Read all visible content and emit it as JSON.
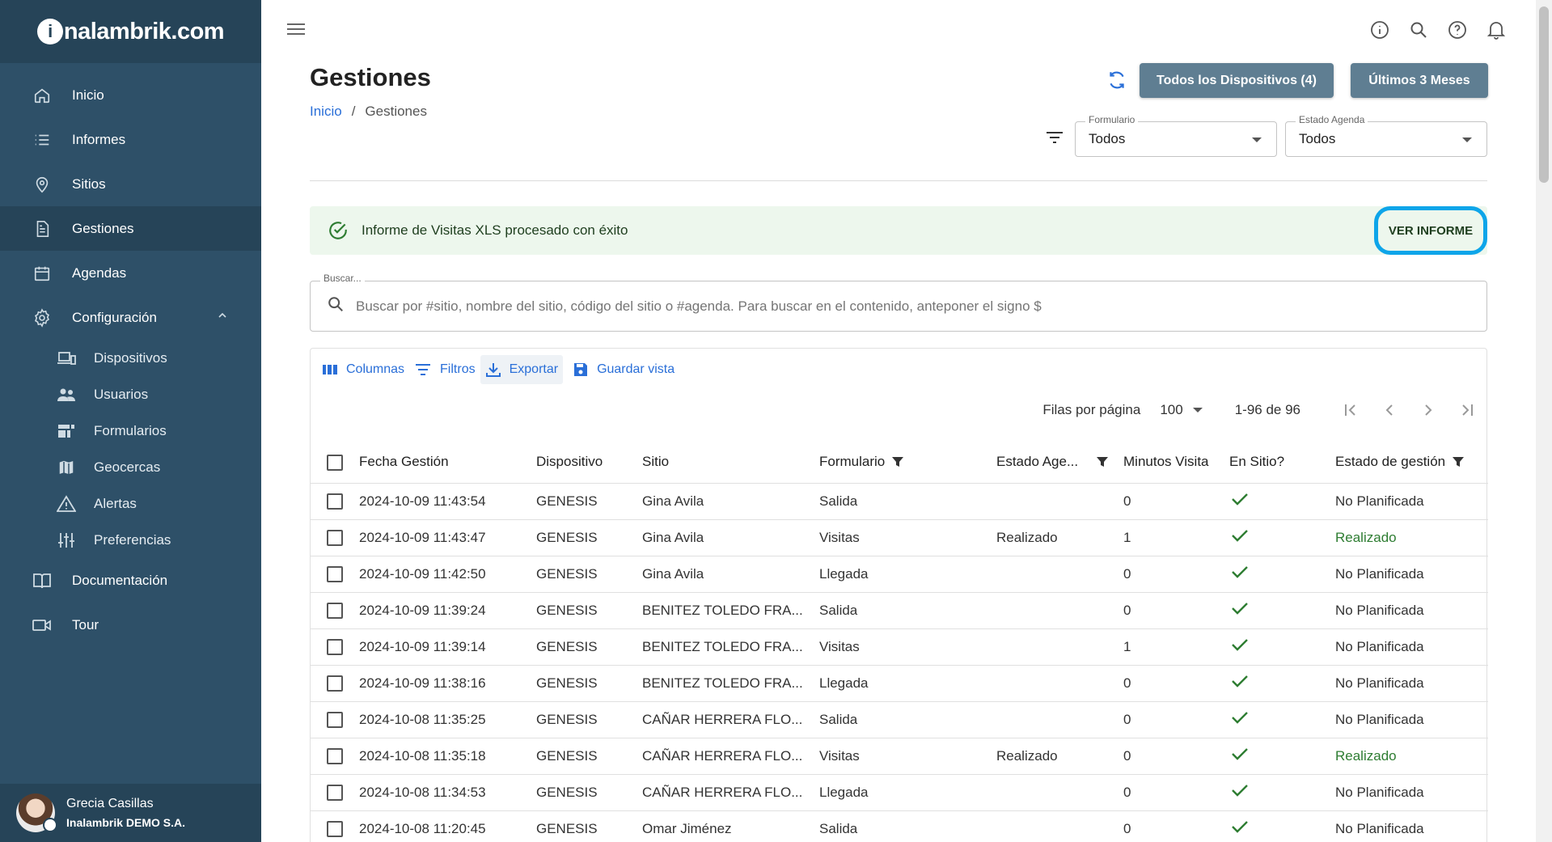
{
  "brand": {
    "logo_text": "nalambrik.com",
    "logo_letter": "i"
  },
  "sidebar": {
    "items": [
      {
        "label": "Inicio",
        "icon": "home-icon"
      },
      {
        "label": "Informes",
        "icon": "list-icon"
      },
      {
        "label": "Sitios",
        "icon": "location-pin-icon"
      },
      {
        "label": "Gestiones",
        "icon": "document-icon",
        "active": true
      },
      {
        "label": "Agendas",
        "icon": "calendar-icon"
      },
      {
        "label": "Configuración",
        "icon": "gear-icon",
        "expanded": true
      }
    ],
    "sub_items": [
      {
        "label": "Dispositivos",
        "icon": "devices-icon"
      },
      {
        "label": "Usuarios",
        "icon": "users-icon"
      },
      {
        "label": "Formularios",
        "icon": "forms-icon"
      },
      {
        "label": "Geocercas",
        "icon": "map-icon"
      },
      {
        "label": "Alertas",
        "icon": "warning-icon"
      },
      {
        "label": "Preferencias",
        "icon": "sliders-icon"
      }
    ],
    "bottom_items": [
      {
        "label": "Documentación",
        "icon": "book-icon"
      },
      {
        "label": "Tour",
        "icon": "video-icon"
      }
    ],
    "user": {
      "name": "Grecia Casillas",
      "org": "Inalambrik DEMO S.A."
    }
  },
  "header": {
    "title": "Gestiones",
    "breadcrumb": {
      "home": "Inicio",
      "separator": "/",
      "current": "Gestiones"
    },
    "devices_button": "Todos los Dispositivos (4)",
    "period_button": "Últimos 3 Meses",
    "form_filter": {
      "legend": "Formulario",
      "value": "Todos"
    },
    "agenda_filter": {
      "legend": "Estado Agenda",
      "value": "Todos"
    }
  },
  "alert": {
    "message": "Informe de Visitas XLS procesado con éxito",
    "action": "VER INFORME"
  },
  "search": {
    "legend": "Buscar...",
    "placeholder": "Buscar por #sitio, nombre del sitio, código del sitio o #agenda. Para buscar en el contenido, anteponer el signo $"
  },
  "toolbar": {
    "columns": "Columnas",
    "filters": "Filtros",
    "export": "Exportar",
    "save_view": "Guardar vista"
  },
  "pager": {
    "rows_label": "Filas por página",
    "rows_value": "100",
    "range": "1-96 de 96"
  },
  "table": {
    "columns": [
      "Fecha Gestión",
      "Dispositivo",
      "Sitio",
      "Formulario",
      "Estado Age...",
      "Minutos Visita",
      "En Sitio?",
      "Estado de gestión"
    ],
    "rows": [
      [
        "2024-10-09 11:43:54",
        "GENESIS",
        "Gina Avila",
        "Salida",
        "",
        "0",
        "check",
        "No Planificada"
      ],
      [
        "2024-10-09 11:43:47",
        "GENESIS",
        "Gina Avila",
        "Visitas",
        "Realizado",
        "1",
        "check",
        "Realizado"
      ],
      [
        "2024-10-09 11:42:50",
        "GENESIS",
        "Gina Avila",
        "Llegada",
        "",
        "0",
        "check",
        "No Planificada"
      ],
      [
        "2024-10-09 11:39:24",
        "GENESIS",
        "BENITEZ TOLEDO FRA...",
        "Salida",
        "",
        "0",
        "check",
        "No Planificada"
      ],
      [
        "2024-10-09 11:39:14",
        "GENESIS",
        "BENITEZ TOLEDO FRA...",
        "Visitas",
        "",
        "1",
        "check",
        "No Planificada"
      ],
      [
        "2024-10-09 11:38:16",
        "GENESIS",
        "BENITEZ TOLEDO FRA...",
        "Llegada",
        "",
        "0",
        "check",
        "No Planificada"
      ],
      [
        "2024-10-08 11:35:25",
        "GENESIS",
        "CAÑAR HERRERA FLO...",
        "Salida",
        "",
        "0",
        "check",
        "No Planificada"
      ],
      [
        "2024-10-08 11:35:18",
        "GENESIS",
        "CAÑAR HERRERA FLO...",
        "Visitas",
        "Realizado",
        "0",
        "check",
        "Realizado"
      ],
      [
        "2024-10-08 11:34:53",
        "GENESIS",
        "CAÑAR HERRERA FLO...",
        "Llegada",
        "",
        "0",
        "check",
        "No Planificada"
      ],
      [
        "2024-10-08 11:20:45",
        "GENESIS",
        "Omar Jiménez",
        "Salida",
        "",
        "0",
        "check",
        "No Planificada"
      ]
    ]
  },
  "colors": {
    "sidebar_bg": "#2e5068",
    "sidebar_active": "#264458",
    "accent": "#2a6fd8",
    "button_dark": "#5f7e92",
    "success_green": "#2e7d32",
    "alert_bg": "#edf7ed",
    "highlight_ring": "#0ea5e9"
  }
}
